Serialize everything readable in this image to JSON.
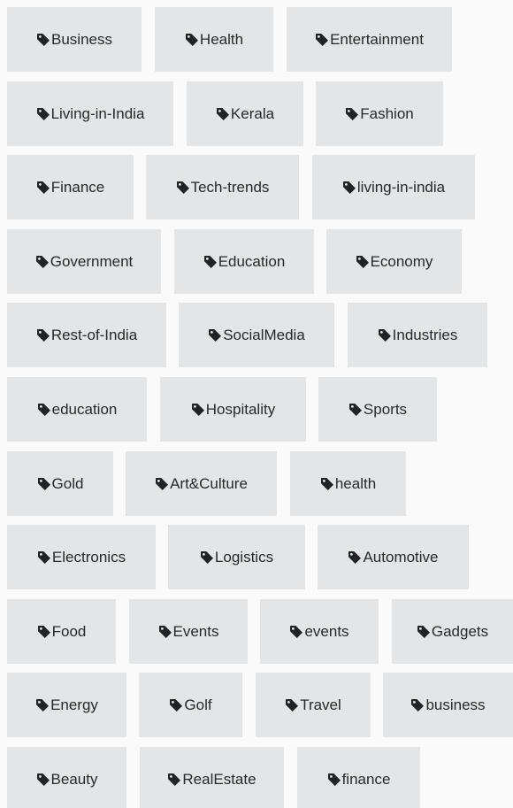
{
  "tag_icon": "tag-icon",
  "colors": {
    "background": "#fafafa",
    "tag_background": "#e4e5e6",
    "tag_text": "#26292c"
  },
  "rows": [
    [
      "Business",
      "Health",
      "Entertainment"
    ],
    [
      "Living-in-India",
      "Kerala",
      "Fashion"
    ],
    [
      "Finance",
      "Tech-trends",
      "living-in-india"
    ],
    [
      "Government",
      "Education",
      "Economy"
    ],
    [
      "Rest-of-India",
      "SocialMedia",
      "Industries"
    ],
    [
      "education",
      "Hospitality",
      "Sports"
    ],
    [
      "Gold",
      "Art&Culture",
      "health"
    ],
    [
      "Electronics",
      "Logistics",
      "Automotive"
    ],
    [
      "Food",
      "Events",
      "events",
      "Gadgets"
    ],
    [
      "Energy",
      "Golf",
      "Travel",
      "business"
    ],
    [
      "Beauty",
      "RealEstate",
      "finance"
    ]
  ]
}
